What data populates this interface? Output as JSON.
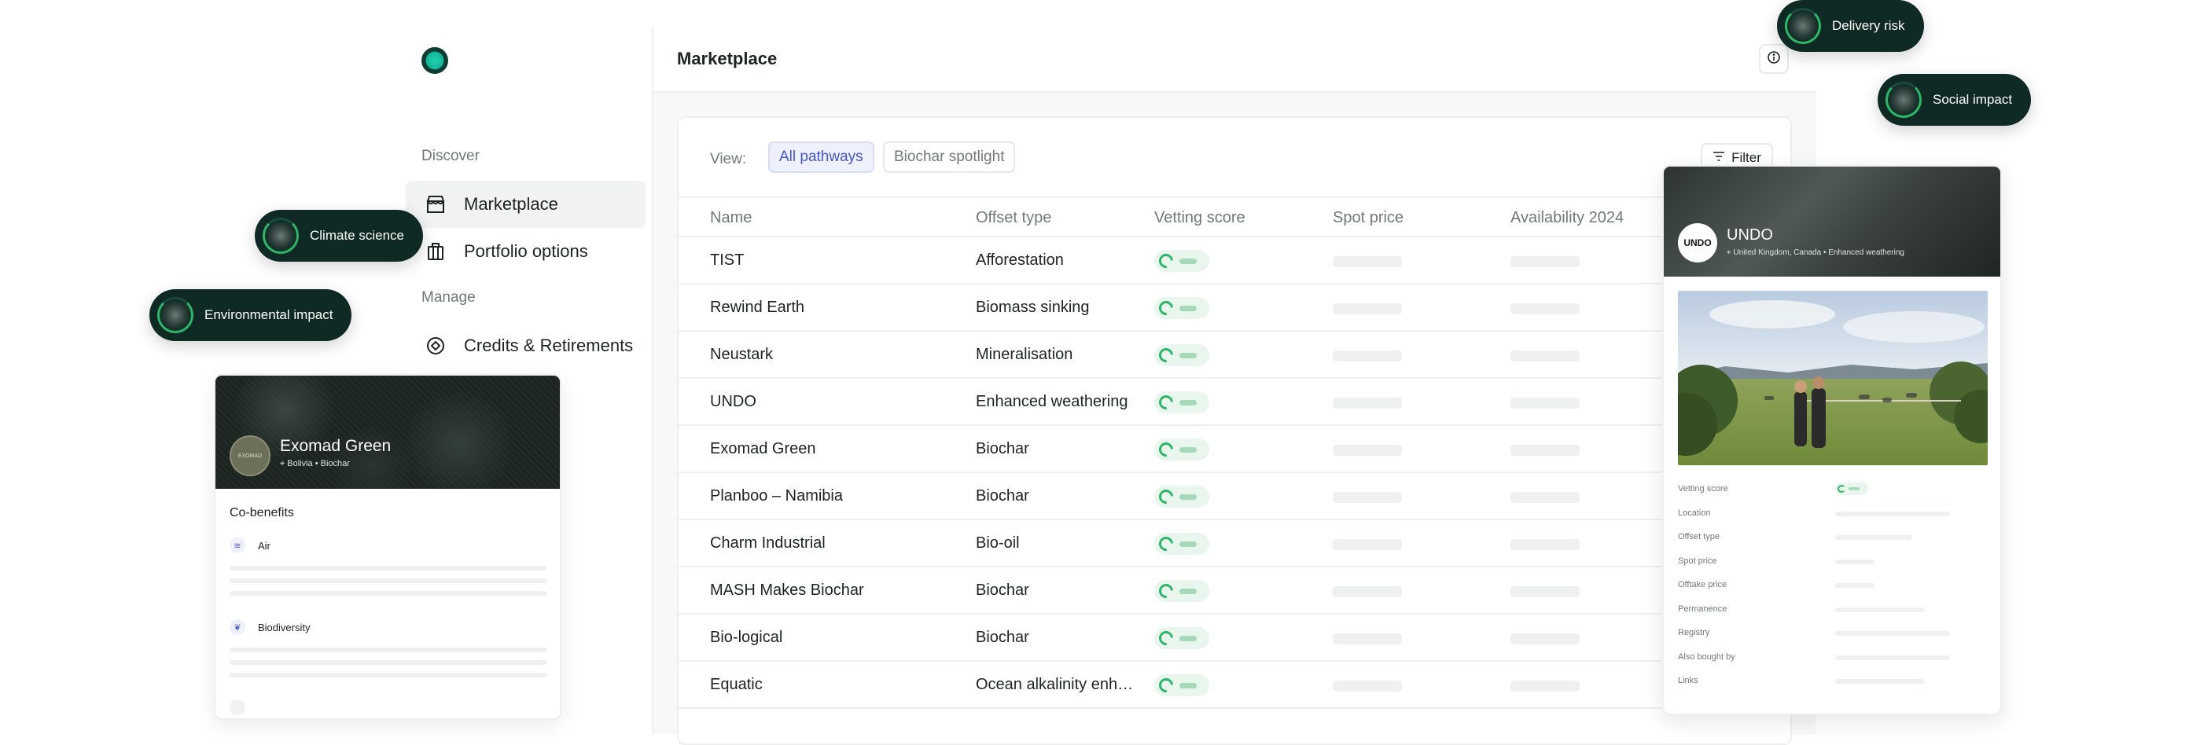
{
  "sidebar": {
    "discover_heading": "Discover",
    "manage_heading": "Manage",
    "items": [
      {
        "label": "Marketplace",
        "icon": "store-icon",
        "active": true
      },
      {
        "label": "Portfolio options",
        "icon": "briefcase-icon",
        "active": false
      },
      {
        "label": "Credits & Retirements",
        "icon": "target-icon",
        "active": false
      }
    ]
  },
  "header": {
    "title": "Marketplace"
  },
  "toolbar": {
    "view_label": "View:",
    "views": [
      "All pathways",
      "Biochar spotlight"
    ],
    "selected_view": "All pathways",
    "filter_label": "Filter"
  },
  "table": {
    "columns": [
      "Name",
      "Offset type",
      "Vetting score",
      "Spot price",
      "Availability 2024"
    ],
    "rows": [
      {
        "name": "TIST",
        "type": "Afforestation"
      },
      {
        "name": "Rewind Earth",
        "type": "Biomass sinking"
      },
      {
        "name": "Neustark",
        "type": "Mineralisation"
      },
      {
        "name": "UNDO",
        "type": "Enhanced weathering"
      },
      {
        "name": "Exomad Green",
        "type": "Biochar"
      },
      {
        "name": "Planboo – Namibia",
        "type": "Biochar"
      },
      {
        "name": "Charm Industrial",
        "type": "Bio-oil"
      },
      {
        "name": "MASH Makes Biochar",
        "type": "Biochar"
      },
      {
        "name": "Bio-logical",
        "type": "Biochar"
      },
      {
        "name": "Equatic",
        "type": "Ocean alkalinity enhan..."
      }
    ]
  },
  "tags": {
    "climate": "Climate science",
    "environmental": "Environmental impact",
    "delivery": "Delivery risk",
    "social": "Social impact"
  },
  "exomad_card": {
    "title": "Exomad Green",
    "location": "Bolivia",
    "type": "Biochar",
    "avatar_text": "EXOMAD",
    "cobenefits_heading": "Co-benefits",
    "cobenefits": [
      "Air",
      "Biodiversity"
    ]
  },
  "undo_card": {
    "title": "UNDO",
    "avatar_text": "UNDO",
    "location": "United Kingdom, Canada",
    "type": "Enhanced weathering",
    "details": [
      "Vetting score",
      "Location",
      "Offset type",
      "Spot price",
      "Offtake price",
      "Permanence",
      "Registry",
      "Also bought by",
      "Links"
    ]
  },
  "colors": {
    "brand_dark": "#0f2a24",
    "accent_green": "#2fb567",
    "selected_view": "#4656c9"
  }
}
